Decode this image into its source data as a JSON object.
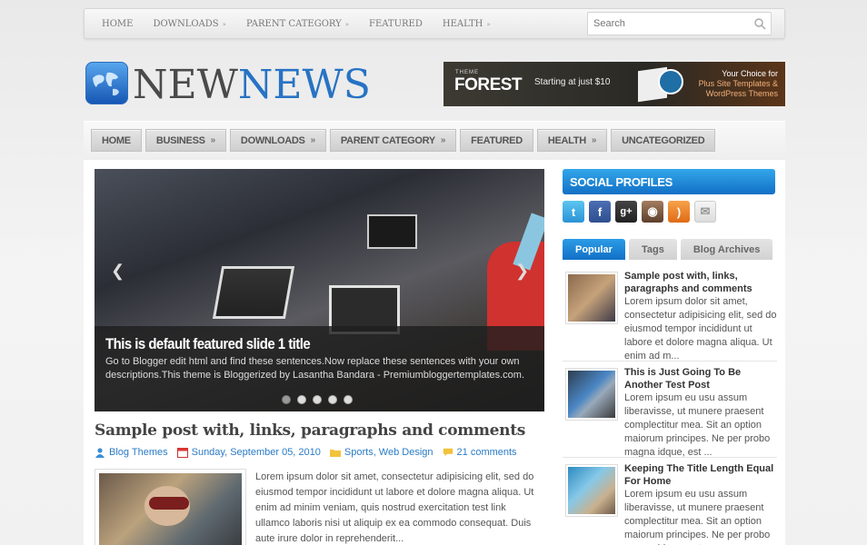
{
  "topnav": {
    "items": [
      {
        "label": "HOME",
        "arrow": ""
      },
      {
        "label": "DOWNLOADS",
        "arrow": "»"
      },
      {
        "label": "PARENT CATEGORY",
        "arrow": "»"
      },
      {
        "label": "FEATURED",
        "arrow": ""
      },
      {
        "label": "HEALTH",
        "arrow": "»"
      }
    ],
    "search_placeholder": "Search"
  },
  "logo": {
    "part1": "NEW",
    "part2": "NEWS"
  },
  "banner": {
    "theme_small": "THEME",
    "brand": "FOREST",
    "start": "Starting at just $10",
    "line1": "Your Choice for",
    "line2": "Plus Site Templates &",
    "line3": "WordPress Themes"
  },
  "mainnav": {
    "items": [
      {
        "label": "HOME",
        "arrow": ""
      },
      {
        "label": "BUSINESS",
        "arrow": "»"
      },
      {
        "label": "DOWNLOADS",
        "arrow": "»"
      },
      {
        "label": "PARENT CATEGORY",
        "arrow": "»"
      },
      {
        "label": "FEATURED",
        "arrow": ""
      },
      {
        "label": "HEALTH",
        "arrow": "»"
      },
      {
        "label": "UNCATEGORIZED",
        "arrow": ""
      }
    ]
  },
  "slider": {
    "title": "This is default featured slide 1 title",
    "text": "Go to Blogger edit html and find these sentences.Now replace these sentences with your own descriptions.This theme is Bloggerized by Lasantha Bandara - Premiumbloggertemplates.com.",
    "prev": "❮",
    "next": "❯",
    "dot_count": 5,
    "active_dot": 1
  },
  "post": {
    "title": "Sample post with, links, paragraphs and comments",
    "author": "Blog Themes",
    "date": "Sunday, September 05, 2010",
    "categories": "Sports, Web Design",
    "comments": "21 comments",
    "excerpt": "Lorem ipsum dolor sit amet, consectetur adipisicing elit, sed do eiusmod tempor incididunt ut labore et dolore magna aliqua. Ut enim ad minim veniam, quis nostrud exercitation test link ullamco laboris nisi ut aliquip ex ea commodo consequat. Duis aute irure dolor in reprehenderit..."
  },
  "sidebar": {
    "social_title": "SOCIAL PROFILES",
    "social_icons": [
      "twitter-icon",
      "facebook-icon",
      "google-plus-icon",
      "instagram-icon",
      "rss-icon",
      "email-icon"
    ],
    "tabs": [
      "Popular",
      "Tags",
      "Blog Archives"
    ],
    "posts": [
      {
        "title": "Sample post with, links, paragraphs and comments",
        "text": "Lorem ipsum dolor sit amet, consectetur adipisicing elit, sed do eiusmod tempor incididunt ut labore et dolore magna aliqua. Ut enim ad m..."
      },
      {
        "title": "This is Just Going To Be Another Test Post",
        "text": "Lorem ipsum eu usu assum liberavisse, ut munere praesent complectitur mea. Sit an option maiorum principes. Ne per probo magna idque, est ..."
      },
      {
        "title": "Keeping The Title Length Equal For Home",
        "text": "Lorem ipsum eu usu assum liberavisse, ut munere praesent complectitur mea. Sit an option maiorum principes. Ne per probo magna idque, est ..."
      }
    ]
  },
  "colors": {
    "accent": "#2773c4",
    "link": "#2a7bc6",
    "sidebar_head": "#1a86d6"
  }
}
